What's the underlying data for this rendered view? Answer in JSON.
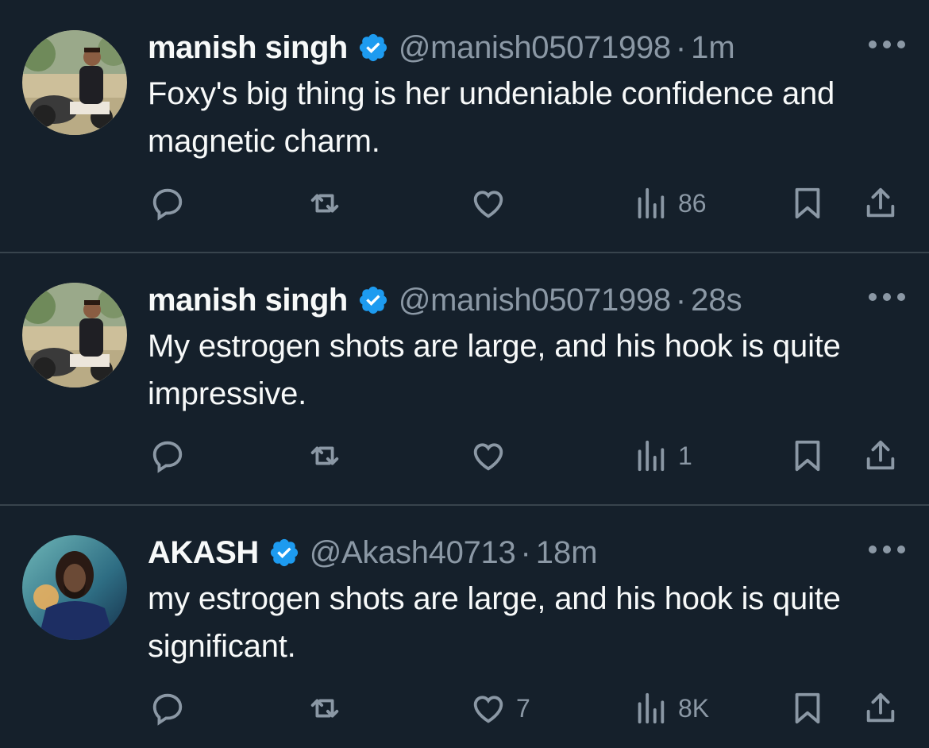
{
  "tweets": [
    {
      "name": "manish singh",
      "handle": "@manish05071998",
      "separator": "·",
      "time": "1m",
      "text": "Foxy's big thing is her undeniable confidence and magnetic charm.",
      "likes": "",
      "views": "86"
    },
    {
      "name": "manish singh",
      "handle": "@manish05071998",
      "separator": "·",
      "time": "28s",
      "text": "My estrogen shots are large, and his hook is quite impressive.",
      "likes": "",
      "views": "1"
    },
    {
      "name": "AKASH",
      "handle": "@Akash40713",
      "separator": "·",
      "time": "18m",
      "text": "my estrogen shots are large, and his hook is quite significant.",
      "likes": "7",
      "views": "8K"
    }
  ],
  "colors": {
    "background": "#15202b",
    "divider": "#38444d",
    "text": "#f7f9f9",
    "muted": "#8b98a5",
    "verified": "#1d9bf0"
  },
  "icons": [
    "verified-badge-icon",
    "more-icon",
    "reply-icon",
    "retweet-icon",
    "like-icon",
    "views-icon",
    "bookmark-icon",
    "share-icon"
  ]
}
